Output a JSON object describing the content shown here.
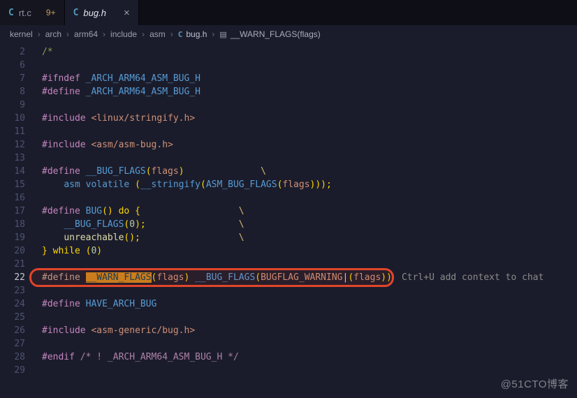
{
  "icons": {
    "c_file": "C",
    "close": "×",
    "symbol": "▤"
  },
  "colors": {
    "annotation_red": "#e2452a",
    "word_highlight_orange": "#c9831d",
    "c_icon_blue": "#519aba"
  },
  "tabs": [
    {
      "label": "rt.c",
      "badge": "9+",
      "active": false
    },
    {
      "label": "bug.h",
      "badge": "",
      "active": true
    }
  ],
  "breadcrumb": {
    "separator": "›",
    "items": [
      "kernel",
      "arch",
      "arm64",
      "include",
      "asm"
    ],
    "file": "bug.h",
    "symbol": "__WARN_FLAGS(flags)"
  },
  "editor": {
    "hint": "Ctrl+U add context to chat",
    "lines": [
      {
        "n": "2",
        "t": [
          [
            "c1",
            "/*"
          ]
        ]
      },
      {
        "n": "6",
        "t": []
      },
      {
        "n": "7",
        "t": [
          [
            "kw",
            "#ifndef "
          ],
          [
            "id",
            "_ARCH_ARM64_ASM_BUG_H"
          ]
        ]
      },
      {
        "n": "8",
        "t": [
          [
            "kw",
            "#define "
          ],
          [
            "id",
            "_ARCH_ARM64_ASM_BUG_H"
          ]
        ]
      },
      {
        "n": "9",
        "t": []
      },
      {
        "n": "10",
        "t": [
          [
            "kw",
            "#include "
          ],
          [
            "str",
            "<linux/stringify.h>"
          ]
        ]
      },
      {
        "n": "11",
        "t": []
      },
      {
        "n": "12",
        "t": [
          [
            "kw",
            "#include "
          ],
          [
            "str",
            "<asm/asm-bug.h>"
          ]
        ]
      },
      {
        "n": "13",
        "t": []
      },
      {
        "n": "14",
        "t": [
          [
            "kw",
            "#define "
          ],
          [
            "id",
            "__BUG_FLAGS"
          ],
          [
            "par",
            "("
          ],
          [
            "str",
            "flags"
          ],
          [
            "par",
            ")"
          ],
          [
            "pl",
            "              "
          ],
          [
            "esc",
            "\\"
          ]
        ]
      },
      {
        "n": "15",
        "t": [
          [
            "pl",
            "    "
          ],
          [
            "id",
            "asm volatile "
          ],
          [
            "par",
            "("
          ],
          [
            "id",
            "__stringify"
          ],
          [
            "par",
            "("
          ],
          [
            "id",
            "ASM_BUG_FLAGS"
          ],
          [
            "par",
            "("
          ],
          [
            "str",
            "flags"
          ],
          [
            "par",
            ")));"
          ]
        ]
      },
      {
        "n": "16",
        "t": []
      },
      {
        "n": "17",
        "t": [
          [
            "kw",
            "#define "
          ],
          [
            "id",
            "BUG"
          ],
          [
            "par",
            "() "
          ],
          [
            "par",
            "do {"
          ],
          [
            "pl",
            "                  "
          ],
          [
            "esc",
            "\\"
          ]
        ]
      },
      {
        "n": "18",
        "t": [
          [
            "pl",
            "    "
          ],
          [
            "id",
            "__BUG_FLAGS"
          ],
          [
            "par",
            "("
          ],
          [
            "num",
            "0"
          ],
          [
            "par",
            ");"
          ],
          [
            "pl",
            "                 "
          ],
          [
            "esc",
            "\\"
          ]
        ]
      },
      {
        "n": "19",
        "t": [
          [
            "pl",
            "    "
          ],
          [
            "fn",
            "unreachable"
          ],
          [
            "par",
            "();"
          ],
          [
            "pl",
            "                  "
          ],
          [
            "esc",
            "\\"
          ]
        ]
      },
      {
        "n": "20",
        "t": [
          [
            "par",
            "} while ("
          ],
          [
            "num",
            "0"
          ],
          [
            "par",
            ")"
          ]
        ]
      },
      {
        "n": "21",
        "t": []
      },
      {
        "n": "22",
        "boxed": true,
        "hint": true,
        "t": [
          [
            "kw2",
            "#define "
          ],
          [
            "hl",
            "__WARN_FLAGS"
          ],
          [
            "par",
            "("
          ],
          [
            "str",
            "flags"
          ],
          [
            "par",
            ") "
          ],
          [
            "id",
            "__BUG_FLAGS"
          ],
          [
            "par",
            "("
          ],
          [
            "str",
            "BUGFLAG_WARNING"
          ],
          [
            "op",
            "|"
          ],
          [
            "par",
            "("
          ],
          [
            "str",
            "flags"
          ],
          [
            "par",
            "))"
          ]
        ]
      },
      {
        "n": "23",
        "t": []
      },
      {
        "n": "24",
        "t": [
          [
            "kw",
            "#define "
          ],
          [
            "id",
            "HAVE_ARCH_BUG"
          ]
        ]
      },
      {
        "n": "25",
        "t": []
      },
      {
        "n": "26",
        "t": [
          [
            "kw",
            "#include "
          ],
          [
            "str",
            "<asm-generic/bug.h>"
          ]
        ]
      },
      {
        "n": "27",
        "t": []
      },
      {
        "n": "28",
        "t": [
          [
            "kw",
            "#endif "
          ],
          [
            "c2",
            "/* ! _ARCH_ARM64_ASM_BUG_H */"
          ]
        ]
      },
      {
        "n": "29",
        "t": []
      }
    ]
  },
  "watermark": "@51CTO博客"
}
